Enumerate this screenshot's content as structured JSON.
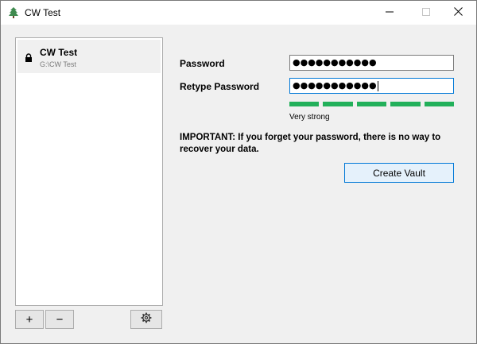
{
  "window": {
    "title": "CW Test",
    "controls": {
      "minimize_icon": "minimize-icon",
      "maximize_icon": "maximize-icon",
      "close_icon": "close-icon"
    }
  },
  "sidebar": {
    "vaults": [
      {
        "name": "CW Test",
        "path": "G:\\CW Test",
        "icon": "lock-icon",
        "selected": true
      }
    ],
    "toolbar": {
      "add_label": "+",
      "remove_label": "−",
      "settings_icon": "gear-icon"
    }
  },
  "form": {
    "password_label": "Password",
    "password_value": "●●●●●●●●●●●",
    "retype_label": "Retype Password",
    "retype_value": "●●●●●●●●●●●",
    "strength": {
      "segments_filled": 5,
      "segments_total": 5,
      "label": "Very strong"
    },
    "warning": "IMPORTANT: If you forget your password, there is no way to recover your data.",
    "create_button_label": "Create Vault"
  },
  "colors": {
    "strength_green": "#22b05a",
    "focus_blue": "#0078d7",
    "selected_item_bg": "#f0f0f0",
    "window_bg": "#f0f0f0"
  }
}
